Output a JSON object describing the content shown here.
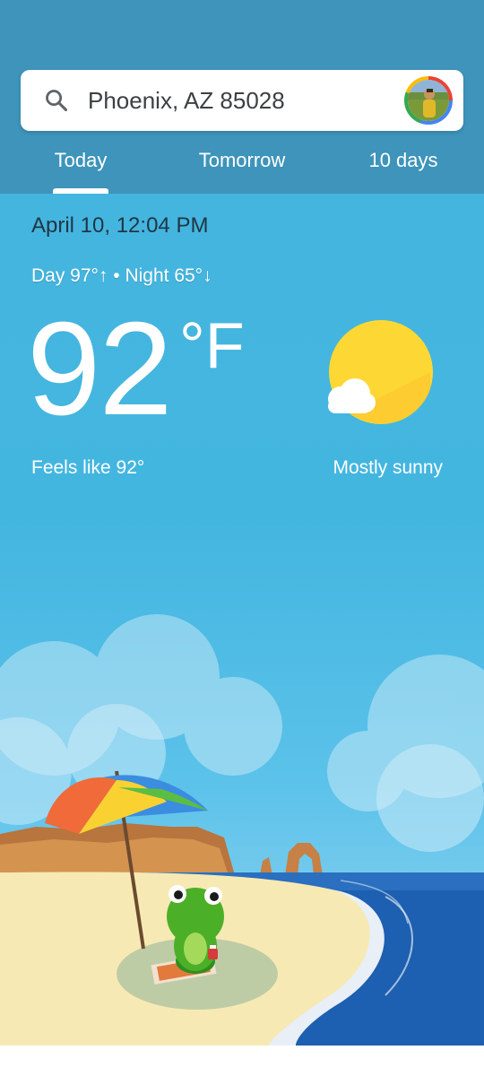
{
  "search": {
    "location": "Phoenix, AZ 85028",
    "icon": "search-icon"
  },
  "tabs": [
    {
      "label": "Today",
      "selected": true
    },
    {
      "label": "Tomorrow",
      "selected": false
    },
    {
      "label": "10 days",
      "selected": false
    }
  ],
  "weather": {
    "datetime": "April 10, 12:04 PM",
    "day_night": "Day 97°↑ • Night 65°↓",
    "temperature": "92",
    "unit": "°F",
    "feels_like": "Feels like 92°",
    "condition": "Mostly sunny",
    "condition_icon": "sun-with-cloud-icon"
  },
  "colors": {
    "header": "#3e94ba",
    "sky": "#45b4de",
    "sun": "#fdd835"
  }
}
